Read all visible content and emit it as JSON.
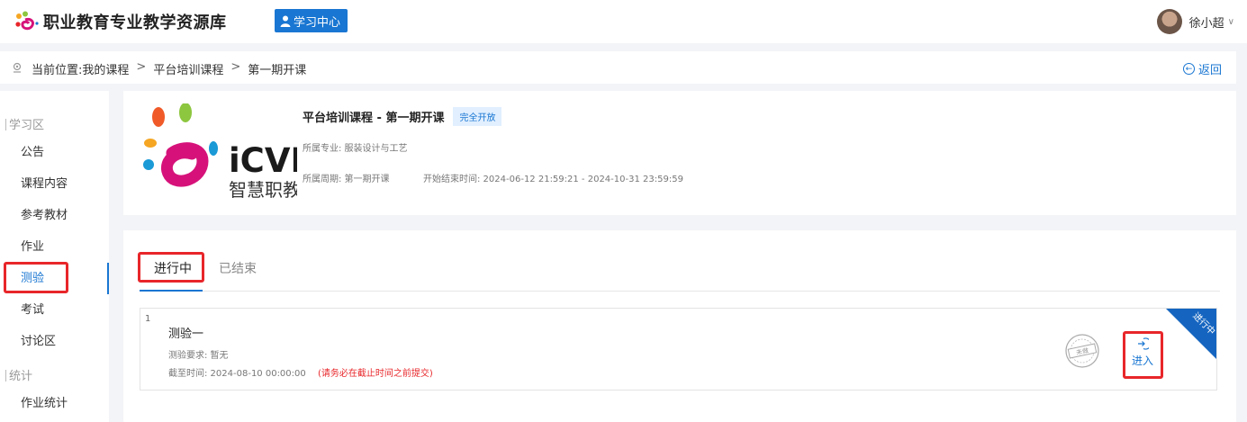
{
  "header": {
    "site_title": "职业教育专业教学资源库",
    "study_center_label": "学习中心",
    "user_name": "徐小超"
  },
  "breadcrumb": {
    "prefix": "当前位置:",
    "items": [
      "我的课程",
      "平台培训课程",
      "第一期开课"
    ],
    "separator": ">",
    "back_label": "返回"
  },
  "sidebar": {
    "sections": [
      {
        "label": "学习区"
      },
      {
        "label": "统计"
      }
    ],
    "items": [
      {
        "label": "公告"
      },
      {
        "label": "课程内容"
      },
      {
        "label": "参考教材"
      },
      {
        "label": "作业"
      },
      {
        "label": "测验",
        "active": true
      },
      {
        "label": "考试"
      },
      {
        "label": "讨论区"
      },
      {
        "label": "作业统计"
      }
    ]
  },
  "course": {
    "logo_text": "iCVE",
    "logo_subtext": "智慧职教",
    "title": "平台培训课程 - 第一期开课",
    "badge": "完全开放",
    "major": "所属专业: 服装设计与工艺",
    "period": "所属周期: 第一期开课",
    "time": "开始结束时间: 2024-06-12 21:59:21 - 2024-10-31 23:59:59"
  },
  "tabs": {
    "active": "进行中",
    "inactive": "已结束"
  },
  "quiz": {
    "index": "1",
    "title": "测验一",
    "requirement": "测验要求: 暂无",
    "deadline": "截至时间: 2024-08-10 00:00:00",
    "warning": "(请务必在截止时间之前提交)",
    "stamp_text": "未做",
    "enter_label": "进入",
    "ribbon_text": "进行中"
  },
  "colors": {
    "accent": "#1976d2",
    "highlight": "#e8262a"
  }
}
